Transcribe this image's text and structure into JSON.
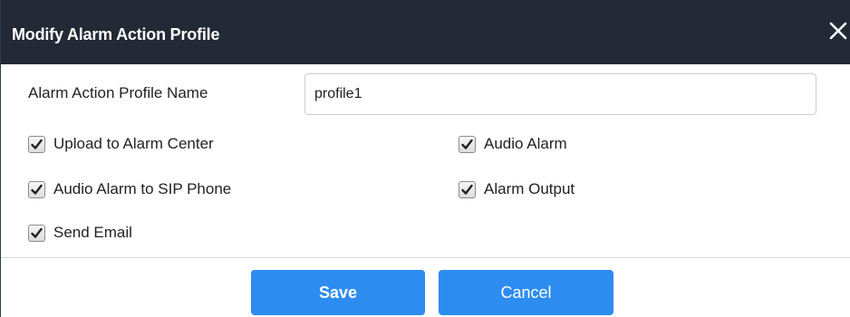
{
  "dialog": {
    "title": "Modify Alarm Action Profile",
    "close_icon": "close-icon"
  },
  "form": {
    "profile_name_label": "Alarm Action Profile Name",
    "profile_name_value": "profile1",
    "checkboxes": [
      {
        "label": "Upload to Alarm Center",
        "checked": true
      },
      {
        "label": "Audio Alarm",
        "checked": true
      },
      {
        "label": "Audio Alarm to SIP Phone",
        "checked": true
      },
      {
        "label": "Alarm Output",
        "checked": true
      },
      {
        "label": "Send Email",
        "checked": true
      }
    ]
  },
  "footer": {
    "save_label": "Save",
    "cancel_label": "Cancel"
  },
  "colors": {
    "titlebar_bg": "#232a36",
    "button_bg": "#2d8cf0"
  }
}
